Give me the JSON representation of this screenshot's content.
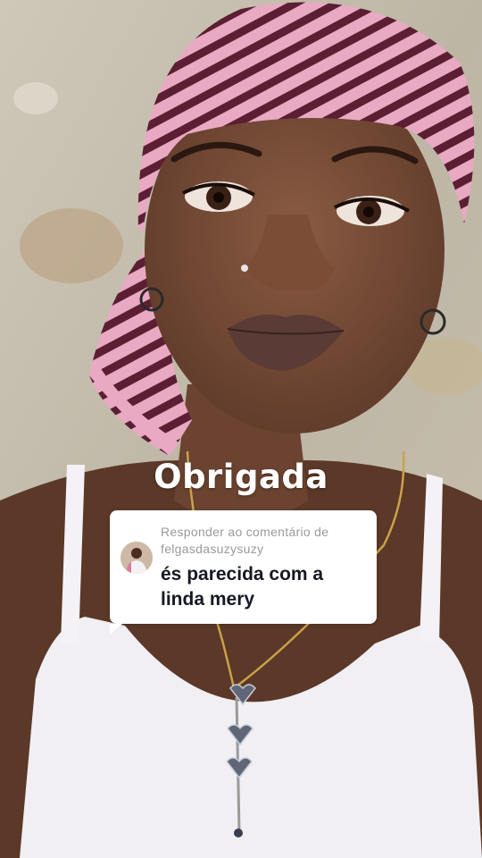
{
  "caption": "Obrigada",
  "reply": {
    "header": "Responder ao comentário de",
    "username": "felgasdasuzysuzy",
    "comment": "és parecida com a linda mery"
  },
  "colors": {
    "caption_text": "#ffffff",
    "bubble_bg": "#ffffff",
    "header_text": "#9a9a9a",
    "comment_text": "#161823",
    "headscarf_pink": "#e7a6c0",
    "headscarf_stripe": "#5b1e33"
  }
}
